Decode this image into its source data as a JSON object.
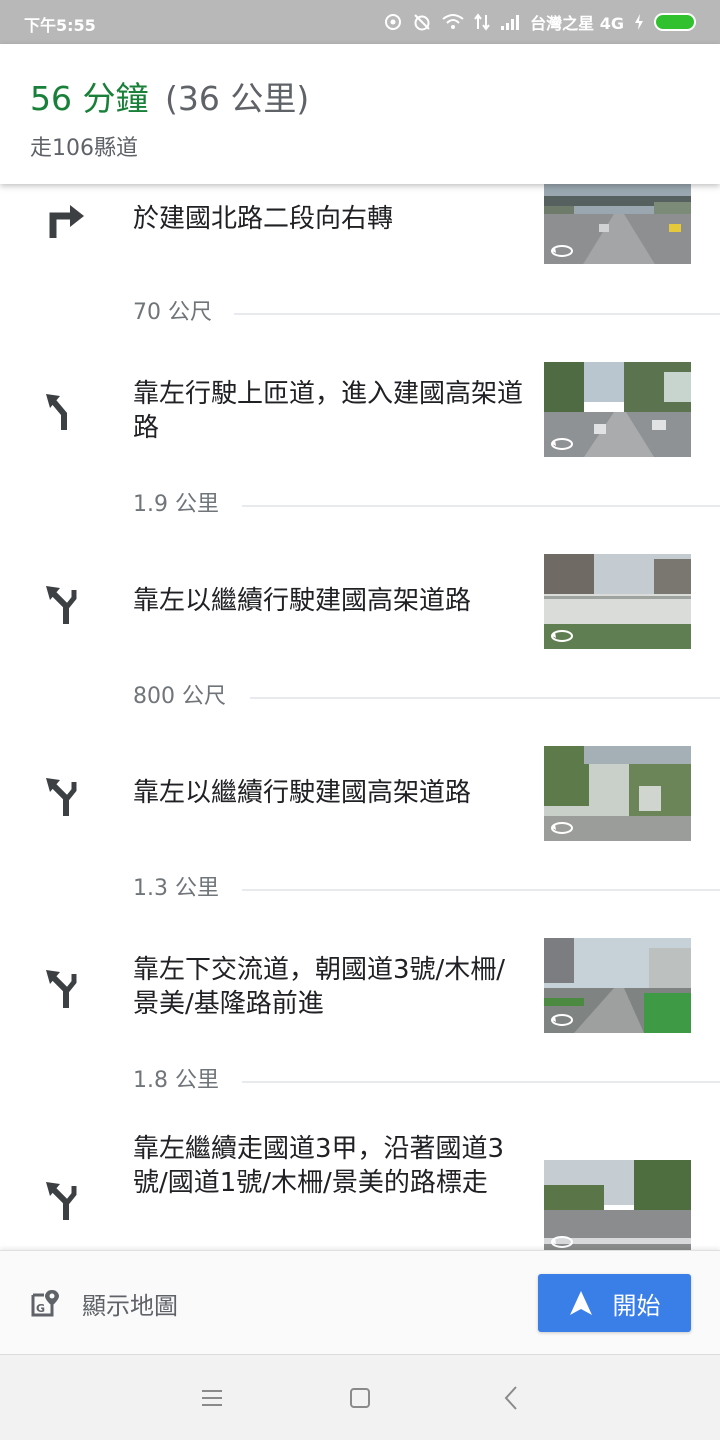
{
  "status_bar": {
    "time": "下午5:55",
    "carrier": "台灣之星 4G"
  },
  "header": {
    "duration": "56 分鐘",
    "distance": "(36 公里)",
    "via": "走106縣道"
  },
  "steps": [
    {
      "icon": "turn-right-icon",
      "instruction": "於建國北路二段向右轉",
      "distance_after": "70 公尺"
    },
    {
      "icon": "keep-left-icon",
      "instruction": "靠左行駛上匝道，進入建國高架道路",
      "distance_after": "1.9 公里"
    },
    {
      "icon": "fork-left-icon",
      "instruction": "靠左以繼續行駛建國高架道路",
      "distance_after": "800 公尺"
    },
    {
      "icon": "fork-left-icon",
      "instruction": "靠左以繼續行駛建國高架道路",
      "distance_after": "1.3 公里"
    },
    {
      "icon": "fork-left-icon",
      "instruction": "靠左下交流道，朝國道3號/木柵/景美/基隆路前進",
      "distance_after": "1.8 公里"
    },
    {
      "icon": "fork-left-icon",
      "instruction": "靠左繼續走國道3甲，沿著國道3號/國道1號/木柵/景美的路標走",
      "distance_after": ""
    }
  ],
  "action_bar": {
    "show_map_label": "顯示地圖",
    "start_label": "開始"
  },
  "colors": {
    "duration_green": "#188038",
    "start_button_blue": "#3a7ee8",
    "status_bar_gray": "#b8b8b8"
  }
}
